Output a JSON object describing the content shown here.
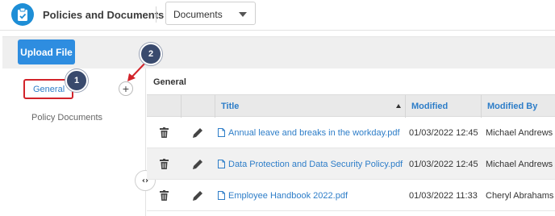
{
  "header": {
    "app_title": "Policies and Documents",
    "view_select": {
      "selected": "Documents"
    }
  },
  "toolbar": {
    "upload_label": "Upload File"
  },
  "folders": [
    {
      "label": "General",
      "selected": true
    },
    {
      "label": "Policy Documents",
      "selected": false
    }
  ],
  "callouts": {
    "first": "1",
    "second": "2"
  },
  "content": {
    "section_title": "General",
    "columns": {
      "title": "Title",
      "modified": "Modified",
      "modified_by": "Modified By"
    },
    "rows": [
      {
        "title": "Annual leave and breaks in the workday.pdf",
        "modified": "01/03/2022 12:45",
        "modified_by": "Michael Andrews"
      },
      {
        "title": "Data Protection and Data Security Policy.pdf",
        "modified": "01/03/2022 12:45",
        "modified_by": "Michael Andrews"
      },
      {
        "title": "Employee Handbook 2022.pdf",
        "modified": "01/03/2022 11:33",
        "modified_by": "Cheryl Abrahams"
      }
    ]
  },
  "colors": {
    "accent": "#2e8de0",
    "link": "#2d7dc8",
    "highlight": "#d2232a",
    "callout": "#394a6d"
  },
  "icons": [
    "clipboard-check-icon",
    "chevron-down-icon",
    "plus-icon",
    "code-toggle-icon",
    "sort-up-icon",
    "trash-icon",
    "pencil-icon",
    "pdf-file-icon"
  ]
}
